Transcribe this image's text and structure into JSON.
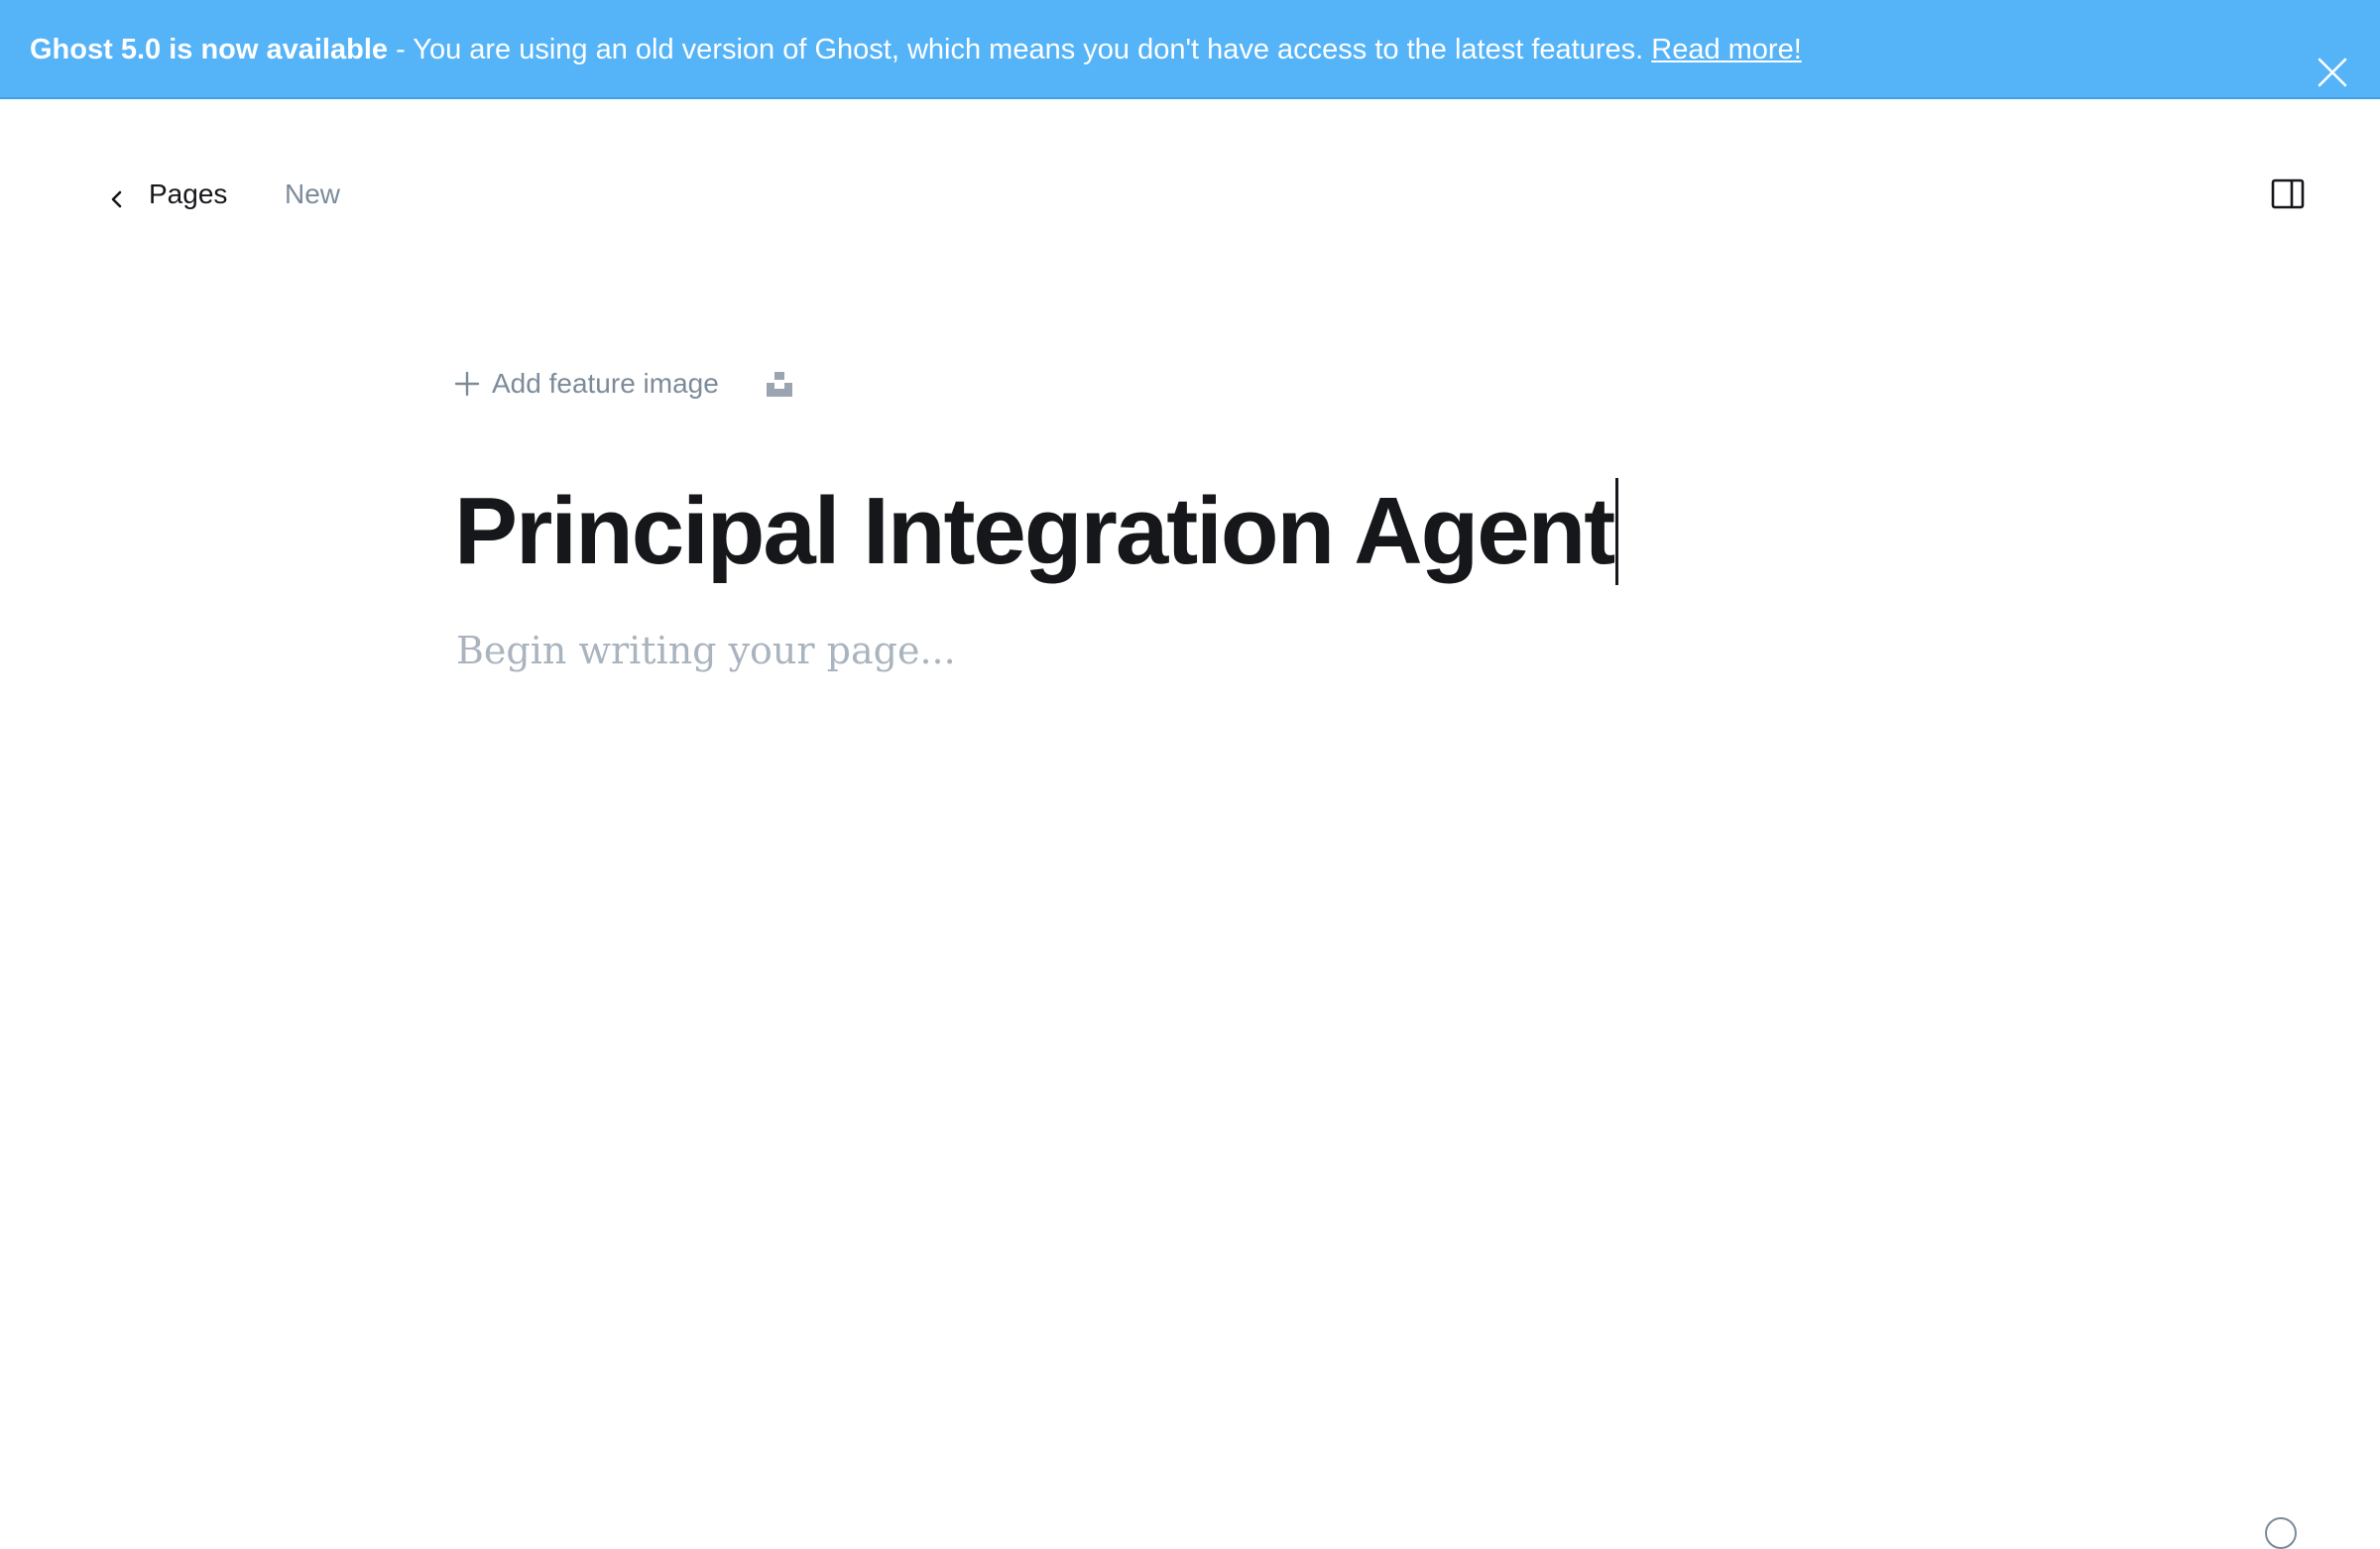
{
  "banner": {
    "strong_text": "Ghost 5.0 is now available",
    "message": " - You are using an old version of Ghost, which means you don't have access to the latest features. ",
    "link_text": "Read more!",
    "close_icon": "close-icon"
  },
  "header": {
    "back_label": "Pages",
    "back_icon": "chevron-left-icon",
    "status": "New",
    "settings_icon": "sidebar-panel-icon"
  },
  "editor": {
    "add_feature_label": "Add feature image",
    "add_feature_icon": "plus-icon",
    "unsplash_icon": "unsplash-icon",
    "title": "Principal Integration Agent",
    "body_placeholder": "Begin writing your page..."
  },
  "colors": {
    "banner_bg": "#55b3f8",
    "text": "#15171a",
    "muted": "#7c8b9a",
    "placeholder": "#a9b4bf"
  }
}
